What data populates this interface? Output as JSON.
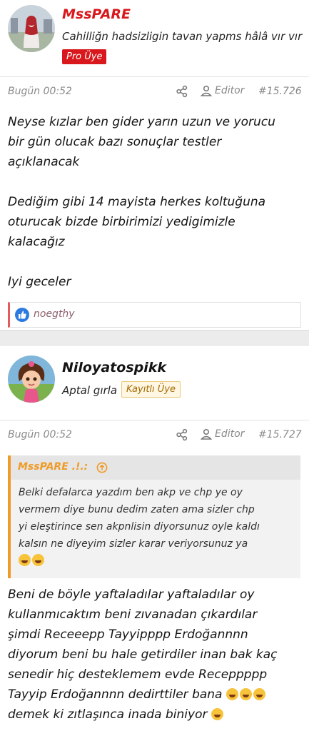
{
  "post1": {
    "username": "MssPARE",
    "user_title": "Cahilliğn hadsizligin tavan yapms hâlâ vır vır",
    "badge": "Pro Üye",
    "date": "Bugün 00:52",
    "editor_label": "Editor",
    "post_number": "#15.726",
    "paragraphs": [
      [
        "Neyse kızlar ben gider yarın uzun ve yorucu",
        "bir gün olucak bazı sonuçlar testler",
        "açıklanacak"
      ],
      [
        "Dediğim gibi 14 mayista herkes koltuğuna",
        "oturucak bizde birbirimizi yedigimizle",
        "kalacağız"
      ],
      [
        "Iyi geceler"
      ]
    ],
    "liker": "noegthy"
  },
  "post2": {
    "username": "Niloyatospikk",
    "user_title": "Aptal gırla",
    "badge": "Kayıtlı Üye",
    "date": "Bugün 00:52",
    "editor_label": "Editor",
    "post_number": "#15.727",
    "quote": {
      "author": "MssPARE .!.:",
      "lines": [
        "Belki defalarca yazdım ben akp ve chp ye oy",
        "vermem diye bunu dedim zaten ama sizler chp",
        "yi eleştirince sen akpnlisin diyorsunuz oyle kaldı",
        "kalsın ne diyeyim sizler karar veriyorsunuz ya"
      ],
      "emoji": "rofl"
    },
    "lines": [
      "Beni de böyle yaftaladılar yaftaladılar oy",
      "kullanmıcaktım beni zıvanadan çıkardılar",
      "şimdi Receeepp Tayyipppp Erdoğannnn",
      "diyorum beni bu hale getirdiler inan bak kaç",
      "senedir hiç desteklemem evde Receppppp",
      "Tayyip Erdoğannnn dedirttiler bana",
      "demek ki zıtlaşınca inada biniyor"
    ],
    "emoji": "grin"
  },
  "colors": {
    "badge_pro": "#d8181c",
    "quote_accent": "#ef9b28",
    "like_blue": "#2d7be0"
  }
}
